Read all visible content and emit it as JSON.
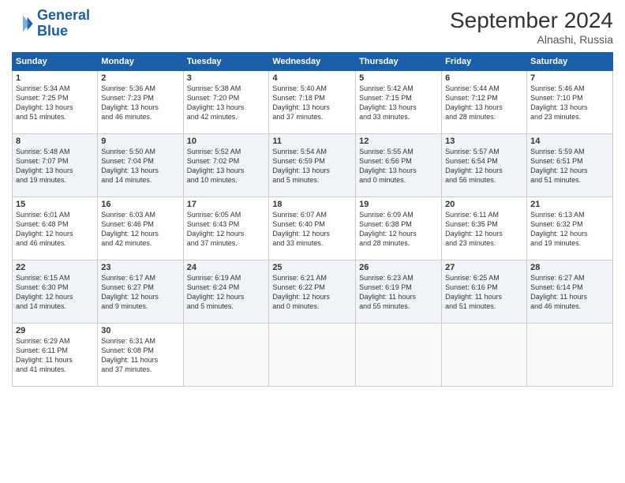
{
  "header": {
    "logo_line1": "General",
    "logo_line2": "Blue",
    "month": "September 2024",
    "location": "Alnashi, Russia"
  },
  "weekdays": [
    "Sunday",
    "Monday",
    "Tuesday",
    "Wednesday",
    "Thursday",
    "Friday",
    "Saturday"
  ],
  "weeks": [
    [
      {
        "day": "1",
        "info": "Sunrise: 5:34 AM\nSunset: 7:25 PM\nDaylight: 13 hours\nand 51 minutes."
      },
      {
        "day": "2",
        "info": "Sunrise: 5:36 AM\nSunset: 7:23 PM\nDaylight: 13 hours\nand 46 minutes."
      },
      {
        "day": "3",
        "info": "Sunrise: 5:38 AM\nSunset: 7:20 PM\nDaylight: 13 hours\nand 42 minutes."
      },
      {
        "day": "4",
        "info": "Sunrise: 5:40 AM\nSunset: 7:18 PM\nDaylight: 13 hours\nand 37 minutes."
      },
      {
        "day": "5",
        "info": "Sunrise: 5:42 AM\nSunset: 7:15 PM\nDaylight: 13 hours\nand 33 minutes."
      },
      {
        "day": "6",
        "info": "Sunrise: 5:44 AM\nSunset: 7:12 PM\nDaylight: 13 hours\nand 28 minutes."
      },
      {
        "day": "7",
        "info": "Sunrise: 5:46 AM\nSunset: 7:10 PM\nDaylight: 13 hours\nand 23 minutes."
      }
    ],
    [
      {
        "day": "8",
        "info": "Sunrise: 5:48 AM\nSunset: 7:07 PM\nDaylight: 13 hours\nand 19 minutes."
      },
      {
        "day": "9",
        "info": "Sunrise: 5:50 AM\nSunset: 7:04 PM\nDaylight: 13 hours\nand 14 minutes."
      },
      {
        "day": "10",
        "info": "Sunrise: 5:52 AM\nSunset: 7:02 PM\nDaylight: 13 hours\nand 10 minutes."
      },
      {
        "day": "11",
        "info": "Sunrise: 5:54 AM\nSunset: 6:59 PM\nDaylight: 13 hours\nand 5 minutes."
      },
      {
        "day": "12",
        "info": "Sunrise: 5:55 AM\nSunset: 6:56 PM\nDaylight: 13 hours\nand 0 minutes."
      },
      {
        "day": "13",
        "info": "Sunrise: 5:57 AM\nSunset: 6:54 PM\nDaylight: 12 hours\nand 56 minutes."
      },
      {
        "day": "14",
        "info": "Sunrise: 5:59 AM\nSunset: 6:51 PM\nDaylight: 12 hours\nand 51 minutes."
      }
    ],
    [
      {
        "day": "15",
        "info": "Sunrise: 6:01 AM\nSunset: 6:48 PM\nDaylight: 12 hours\nand 46 minutes."
      },
      {
        "day": "16",
        "info": "Sunrise: 6:03 AM\nSunset: 6:46 PM\nDaylight: 12 hours\nand 42 minutes."
      },
      {
        "day": "17",
        "info": "Sunrise: 6:05 AM\nSunset: 6:43 PM\nDaylight: 12 hours\nand 37 minutes."
      },
      {
        "day": "18",
        "info": "Sunrise: 6:07 AM\nSunset: 6:40 PM\nDaylight: 12 hours\nand 33 minutes."
      },
      {
        "day": "19",
        "info": "Sunrise: 6:09 AM\nSunset: 6:38 PM\nDaylight: 12 hours\nand 28 minutes."
      },
      {
        "day": "20",
        "info": "Sunrise: 6:11 AM\nSunset: 6:35 PM\nDaylight: 12 hours\nand 23 minutes."
      },
      {
        "day": "21",
        "info": "Sunrise: 6:13 AM\nSunset: 6:32 PM\nDaylight: 12 hours\nand 19 minutes."
      }
    ],
    [
      {
        "day": "22",
        "info": "Sunrise: 6:15 AM\nSunset: 6:30 PM\nDaylight: 12 hours\nand 14 minutes."
      },
      {
        "day": "23",
        "info": "Sunrise: 6:17 AM\nSunset: 6:27 PM\nDaylight: 12 hours\nand 9 minutes."
      },
      {
        "day": "24",
        "info": "Sunrise: 6:19 AM\nSunset: 6:24 PM\nDaylight: 12 hours\nand 5 minutes."
      },
      {
        "day": "25",
        "info": "Sunrise: 6:21 AM\nSunset: 6:22 PM\nDaylight: 12 hours\nand 0 minutes."
      },
      {
        "day": "26",
        "info": "Sunrise: 6:23 AM\nSunset: 6:19 PM\nDaylight: 11 hours\nand 55 minutes."
      },
      {
        "day": "27",
        "info": "Sunrise: 6:25 AM\nSunset: 6:16 PM\nDaylight: 11 hours\nand 51 minutes."
      },
      {
        "day": "28",
        "info": "Sunrise: 6:27 AM\nSunset: 6:14 PM\nDaylight: 11 hours\nand 46 minutes."
      }
    ],
    [
      {
        "day": "29",
        "info": "Sunrise: 6:29 AM\nSunset: 6:11 PM\nDaylight: 11 hours\nand 41 minutes."
      },
      {
        "day": "30",
        "info": "Sunrise: 6:31 AM\nSunset: 6:08 PM\nDaylight: 11 hours\nand 37 minutes."
      },
      {
        "day": "",
        "info": ""
      },
      {
        "day": "",
        "info": ""
      },
      {
        "day": "",
        "info": ""
      },
      {
        "day": "",
        "info": ""
      },
      {
        "day": "",
        "info": ""
      }
    ]
  ]
}
